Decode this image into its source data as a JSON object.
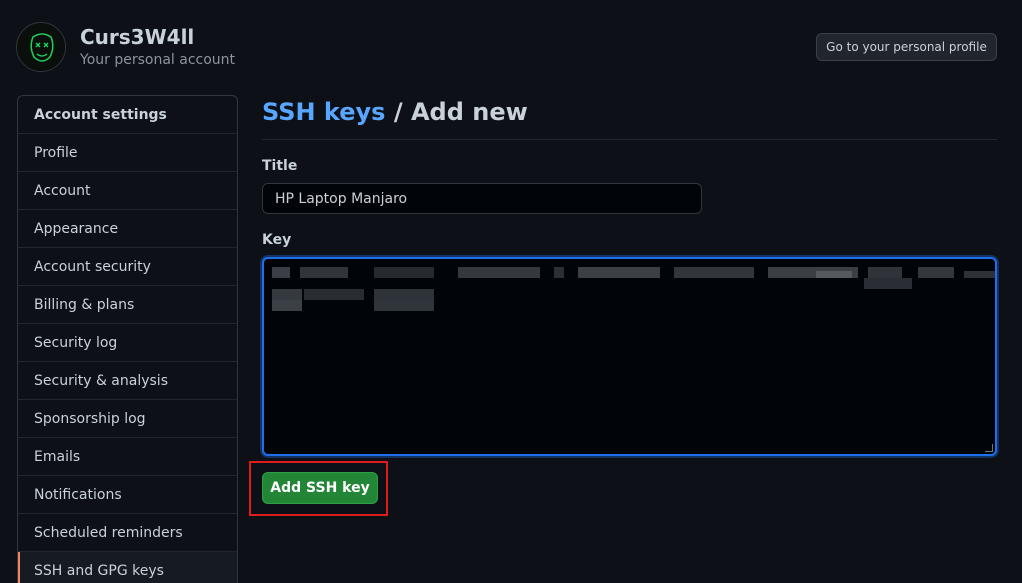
{
  "header": {
    "account_name": "Curs3W4ll",
    "account_subtitle": "Your personal account",
    "profile_button": "Go to your personal profile"
  },
  "sidebar": {
    "heading": "Account settings",
    "items": [
      {
        "label": "Profile"
      },
      {
        "label": "Account"
      },
      {
        "label": "Appearance"
      },
      {
        "label": "Account security"
      },
      {
        "label": "Billing & plans"
      },
      {
        "label": "Security log"
      },
      {
        "label": "Security & analysis"
      },
      {
        "label": "Sponsorship log"
      },
      {
        "label": "Emails"
      },
      {
        "label": "Notifications"
      },
      {
        "label": "Scheduled reminders"
      },
      {
        "label": "SSH and GPG keys",
        "selected": true
      }
    ]
  },
  "main": {
    "breadcrumb_link": "SSH keys",
    "breadcrumb_rest": " / Add new",
    "title_label": "Title",
    "title_value": "HP Laptop Manjaro",
    "key_label": "Key",
    "submit_label": "Add SSH key"
  },
  "colors": {
    "background": "#0d1117",
    "link": "#58a6ff",
    "primary_button": "#238636",
    "focus_border": "#1f6feb",
    "annotation_box": "#e01b1b"
  }
}
